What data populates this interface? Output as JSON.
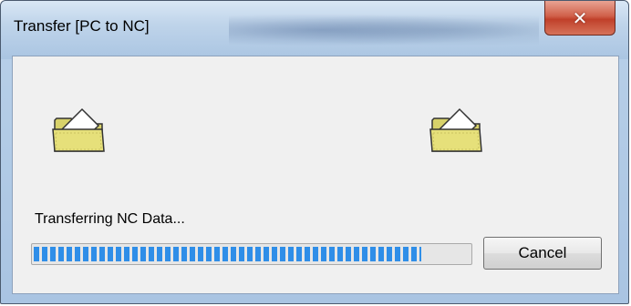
{
  "window": {
    "title": "Transfer [PC to NC]",
    "close_icon": "close-icon"
  },
  "content": {
    "source_icon": "folder-open-icon",
    "destination_icon": "folder-open-icon",
    "status_text": "Transferring NC Data...",
    "progress_fraction": 0.89,
    "progress_color": "#2f8ee8",
    "cancel_label": "Cancel"
  },
  "colors": {
    "close_button": "#c0402a",
    "folder": "#e6e07a"
  }
}
